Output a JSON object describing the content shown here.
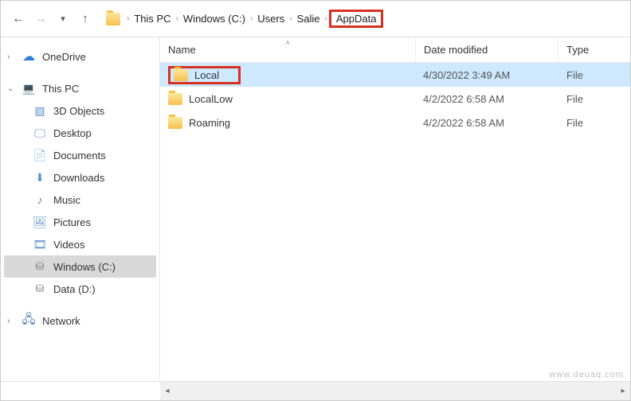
{
  "breadcrumb": {
    "items": [
      "This PC",
      "Windows (C:)",
      "Users",
      "Salie",
      "AppData"
    ],
    "highlighted_index": 4
  },
  "sidebar": {
    "groups": [
      {
        "label": "OneDrive",
        "icon": "cloud"
      },
      {
        "label": "This PC",
        "icon": "pc",
        "children": [
          {
            "label": "3D Objects",
            "icon": "cube"
          },
          {
            "label": "Desktop",
            "icon": "desktop"
          },
          {
            "label": "Documents",
            "icon": "doc"
          },
          {
            "label": "Downloads",
            "icon": "down"
          },
          {
            "label": "Music",
            "icon": "music"
          },
          {
            "label": "Pictures",
            "icon": "pic"
          },
          {
            "label": "Videos",
            "icon": "video"
          },
          {
            "label": "Windows (C:)",
            "icon": "drive",
            "selected": true
          },
          {
            "label": "Data (D:)",
            "icon": "drive"
          }
        ]
      },
      {
        "label": "Network",
        "icon": "net"
      }
    ]
  },
  "columns": {
    "name": "Name",
    "date": "Date modified",
    "type": "Type"
  },
  "rows": [
    {
      "name": "Local",
      "date": "4/30/2022 3:49 AM",
      "type": "File",
      "selected": true,
      "highlighted": true
    },
    {
      "name": "LocalLow",
      "date": "4/2/2022 6:58 AM",
      "type": "File"
    },
    {
      "name": "Roaming",
      "date": "4/2/2022 6:58 AM",
      "type": "File"
    }
  ],
  "watermark": "www.deuaq.com"
}
